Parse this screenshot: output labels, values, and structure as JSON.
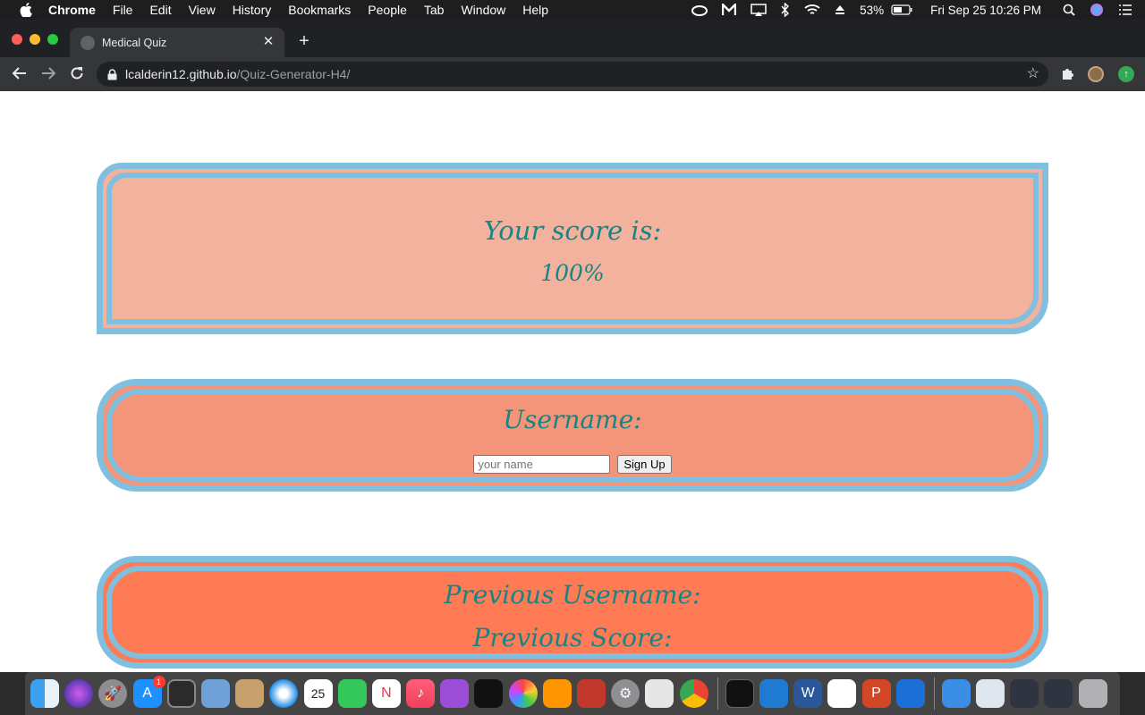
{
  "menubar": {
    "app_name": "Chrome",
    "items": [
      "File",
      "Edit",
      "View",
      "History",
      "Bookmarks",
      "People",
      "Tab",
      "Window",
      "Help"
    ],
    "battery": "53%",
    "datetime": "Fri Sep 25  10:26 PM"
  },
  "browser": {
    "tab_title": "Medical Quiz",
    "url_host": "lcalderin12.github.io",
    "url_path": "/Quiz-Generator-H4/"
  },
  "page": {
    "score_heading": "Your score is:",
    "score_value": "100%",
    "username_heading": "Username:",
    "username_placeholder": "your name",
    "signup_label": "Sign Up",
    "previous_username_label": "Previous Username:",
    "previous_score_label": "Previous Score:"
  },
  "dock": {
    "badge_count": "1",
    "calendar_day": "25"
  }
}
